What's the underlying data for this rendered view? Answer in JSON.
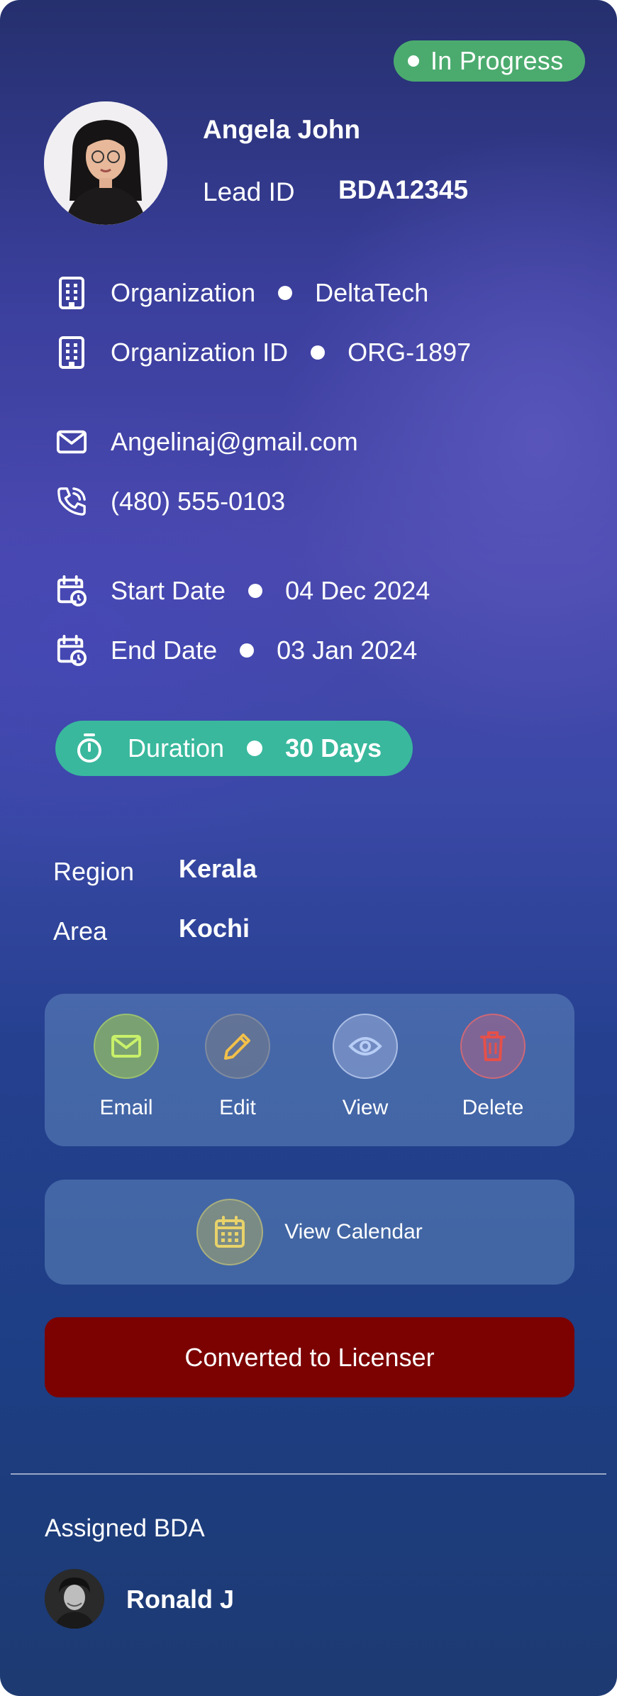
{
  "status": {
    "label": "In Progress",
    "color": "#4bab6e"
  },
  "lead": {
    "name": "Angela John",
    "lead_id_label": "Lead ID",
    "lead_id": "BDA12345"
  },
  "details": {
    "organization_label": "Organization",
    "organization": "DeltaTech",
    "organization_id_label": "Organization ID",
    "organization_id": "ORG-1897",
    "email": "Angelinaj@gmail.com",
    "phone": "(480) 555-0103",
    "start_date_label": "Start Date",
    "start_date": "04 Dec 2024",
    "end_date_label": "End Date",
    "end_date": "03 Jan 2024"
  },
  "duration": {
    "label": "Duration",
    "value": "30 Days",
    "color": "#39b89d"
  },
  "location": {
    "region_label": "Region",
    "region": "Kerala",
    "area_label": "Area",
    "area": "Kochi"
  },
  "actions": {
    "email_label": "Email",
    "edit_label": "Edit",
    "view_label": "View",
    "delete_label": "Delete"
  },
  "calendar": {
    "label": "View Calendar"
  },
  "convert_button": {
    "label": "Converted to Licenser",
    "color": "#7c0101"
  },
  "assigned": {
    "label": "Assigned BDA",
    "name": "Ronald J"
  },
  "icons": {
    "building": "building-icon",
    "mail": "mail-icon",
    "phone": "phone-icon",
    "calendar_clock": "calendar-clock-icon",
    "timer": "timer-icon",
    "pencil": "pencil-icon",
    "eye": "eye-icon",
    "trash": "trash-icon",
    "calendar": "calendar-icon"
  }
}
